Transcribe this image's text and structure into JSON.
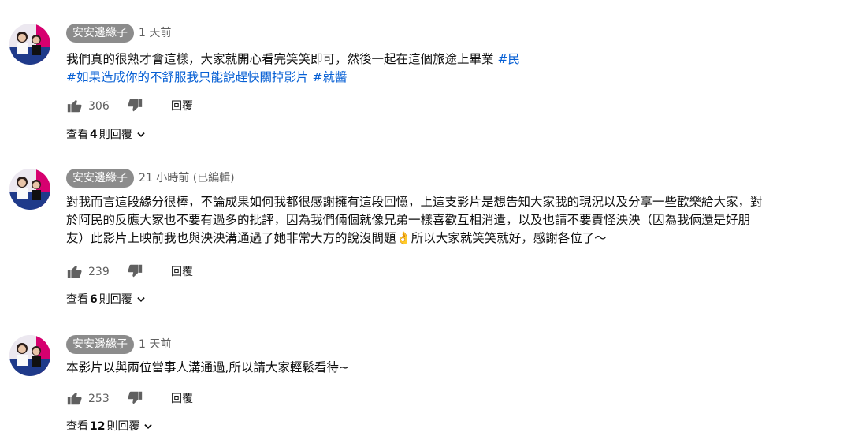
{
  "comments": [
    {
      "author": "安安邊緣子",
      "time": "1 天前",
      "text_line1": "我們真的很熟才會這樣，大家就開心看完笑笑即可，然後一起在這個旅途上畢業 ",
      "hashtag1": "#民",
      "hashtag2": "#如果造成你的不舒服我只能說趕快關掉影片",
      "hashtag3": "#就醬",
      "likes": "306",
      "reply_label": "回覆",
      "view_label": "查看",
      "reply_count": "4",
      "reply_suffix": "則回覆"
    },
    {
      "author": "安安邊緣子",
      "time": "21 小時前 (已編輯)",
      "text_line1": "對我而言這段緣分很棒，不論成果如何我都很感謝擁有這段回憶，上這支影片是想告知大家我的現況以及分享一些歡樂給大家，對",
      "text_line2": "於阿民的反應大家也不要有過多的批評，因為我們倆個就像兄弟一樣喜歡互相消遣，以及也請不要責怪泱泱（因為我倆還是好朋",
      "text_line3": "友）此影片上映前我也與泱泱溝通過了她非常大方的說沒問題👌所以大家就笑笑就好，感謝各位了～",
      "likes": "239",
      "reply_label": "回覆",
      "view_label": "查看",
      "reply_count": "6",
      "reply_suffix": "則回覆"
    },
    {
      "author": "安安邊緣子",
      "time": "1 天前",
      "text_line1": "本影片以與兩位當事人溝通過,所以請大家輕鬆看待~",
      "likes": "253",
      "reply_label": "回覆",
      "view_label": "查看",
      "reply_count": "12",
      "reply_suffix": "則回覆"
    }
  ],
  "icons": {
    "like": "thumbs-up-icon",
    "dislike": "thumbs-down-icon",
    "expand": "chevron-down-icon"
  },
  "colors": {
    "hashtag": "#065fd4",
    "author_badge": "#8c8c8c",
    "secondary_text": "#606060"
  }
}
